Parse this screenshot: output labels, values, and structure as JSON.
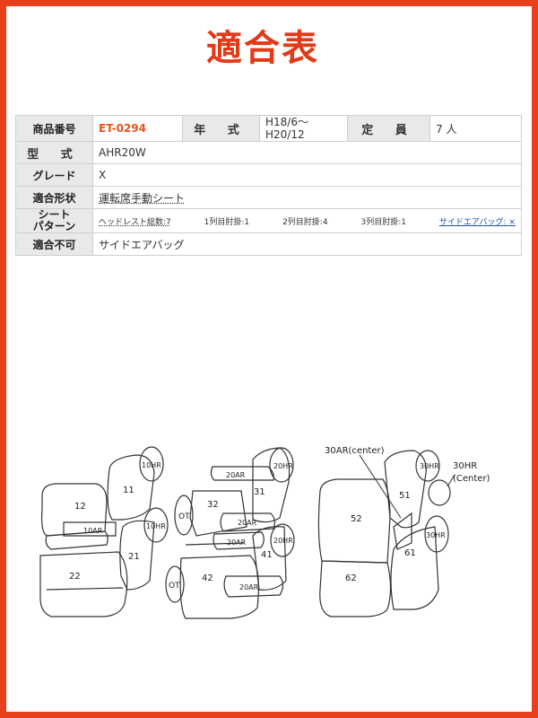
{
  "title": "適合表",
  "spec": {
    "product_no_label": "商品番号",
    "product_no": "ET-0294",
    "year_label": "年 式",
    "year_line1": "H18/6〜",
    "year_line2": "H20/12",
    "capacity_label": "定 員",
    "capacity": "7 人",
    "model_label": "型 式",
    "model": "AHR20W",
    "grade_label": "グレード",
    "grade": "X",
    "fit_label": "適合形状",
    "fit": "運転席手動シート",
    "pattern_label_line1": "シート",
    "pattern_label_line2": "パターン",
    "pattern": {
      "headrest": "ヘッドレスト総数:7",
      "row1": "1列目肘掛:1",
      "row2": "2列目肘掛:4",
      "row3": "3列目肘掛:1",
      "airbag": "サイドエアバッグ: ×"
    },
    "unfit_label": "適合不可",
    "unfit": "サイドエアバッグ"
  },
  "diagram": {
    "labels": {
      "s12": "12",
      "s11": "11",
      "h10hr": "10HR",
      "h10hr2": "10HR",
      "a10ar": "10AR",
      "s21": "21",
      "s22": "22",
      "a20ar_top": "20AR",
      "s31": "31",
      "h20hr_top": "20HR",
      "s32": "32",
      "ot1": "OT",
      "a20ar_mid": "20AR",
      "a20ar_mid2": "20AR",
      "h20hr_mid": "20HR",
      "s41": "41",
      "ot2": "OT",
      "s42": "42",
      "a20ar_bot": "20AR",
      "callout_30ar": "30AR(center)",
      "callout_30hr_line1": "30HR",
      "callout_30hr_line2": "(Center)",
      "h30hr_top": "30HR",
      "s51": "51",
      "s52": "52",
      "h30hr_bot": "30HR",
      "s61": "61",
      "s62": "62"
    }
  }
}
